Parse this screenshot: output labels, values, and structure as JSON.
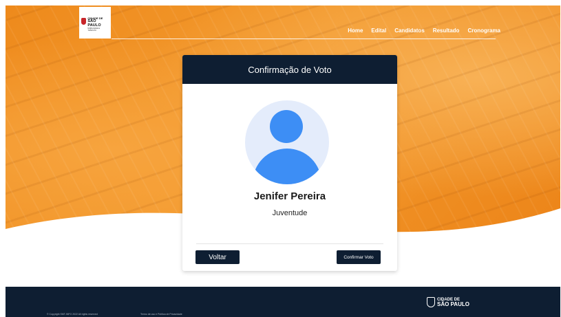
{
  "header": {
    "logo": {
      "line1": "CIDADE DE",
      "line2": "SÃO PAULO",
      "line3": "MOBILIDADE E TRÂNSITO"
    },
    "nav": [
      "Home",
      "Edital",
      "Candidatos",
      "Resultado",
      "Cronograma"
    ]
  },
  "card": {
    "title": "Confirmação de Voto",
    "candidate_name": "Jenifer Pereira",
    "candidate_group": "Juventude",
    "back_label": "Voltar",
    "confirm_label": "Confirmar Voto"
  },
  "footer": {
    "copyright": "© Copyright SMT-INFO 2022 All rights reserved",
    "terms": "Termo de uso e Política de Privacidade",
    "logo": {
      "line1": "CIDADE DE",
      "line2": "SÃO PAULO"
    }
  },
  "colors": {
    "brand_orange": "#ef8a1f",
    "navy": "#0e1e32",
    "avatar_blue": "#3d8ef5",
    "avatar_bg": "#e4ecfb"
  }
}
